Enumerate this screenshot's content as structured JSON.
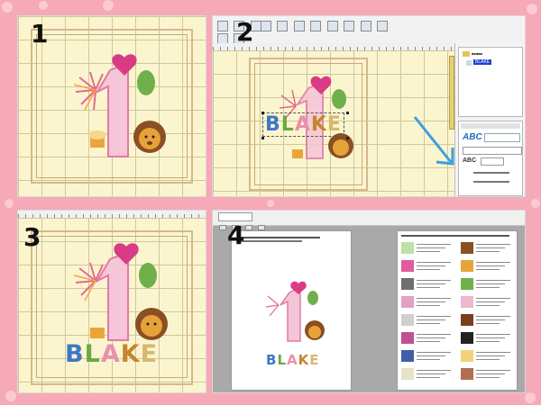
{
  "panels": [
    {
      "number": "1"
    },
    {
      "number": "2"
    },
    {
      "number": "3"
    },
    {
      "number": "4"
    }
  ],
  "design": {
    "name_text": "BLAKE",
    "letter_colors": [
      "#3c78c8",
      "#6aa845",
      "#e98fb0",
      "#c5862d",
      "#d8b770"
    ]
  },
  "panel2": {
    "tree_label": "BLAKE",
    "font_selector_value": "ABC"
  },
  "panel4": {
    "preview_name": "BLAKE",
    "thread_colors": [
      "#bfe0a8",
      "#e15a9f",
      "#6f6f6f",
      "#e3a1c6",
      "#cfcfcf",
      "#c04f93",
      "#3f5fa9",
      "#e7e2c7",
      "#8a4f22",
      "#e7a33a",
      "#6fb04a",
      "#efb7d0",
      "#7b3f1e",
      "#222222",
      "#f0d27a",
      "#b07050"
    ]
  },
  "colors": {
    "background": "#f6a9b6",
    "accent_arrow": "#3aa0dc",
    "selection_blue": "#1f3fd0"
  }
}
